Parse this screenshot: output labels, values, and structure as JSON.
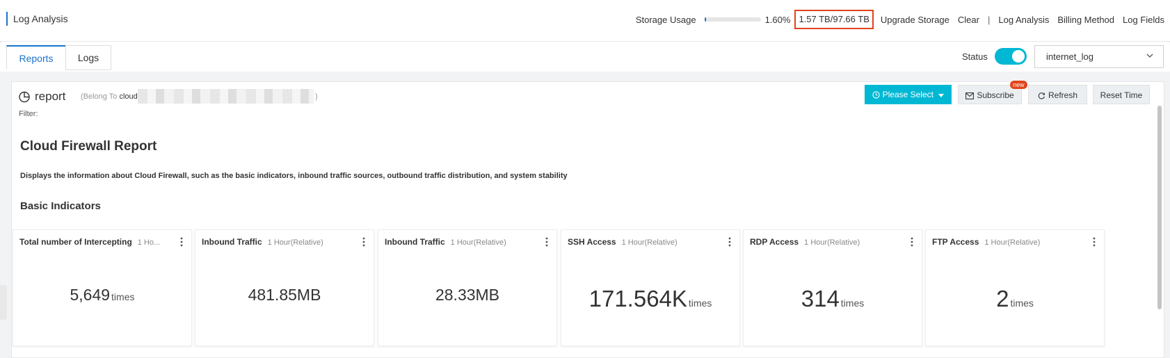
{
  "header": {
    "title": "Log Analysis",
    "storage_label": "Storage Usage",
    "storage_percent": "1.60%",
    "storage_fraction": 0.016,
    "storage_amount": "1.57 TB/97.66 TB",
    "links": [
      "Upgrade Storage",
      "Clear",
      "Log Analysis",
      "Billing Method",
      "Log Fields"
    ],
    "separator": "|"
  },
  "tabs": [
    {
      "label": "Reports",
      "active": true
    },
    {
      "label": "Logs",
      "active": false
    }
  ],
  "status": {
    "label": "Status",
    "enabled": true
  },
  "logstore": {
    "selected": "internet_log"
  },
  "report": {
    "name": "report",
    "belong_prefix": "(Belong To ",
    "belong_project": "cloud",
    "belong_suffix": ")",
    "filter_label": "Filter:",
    "buttons": {
      "select": "Please Select",
      "subscribe": "Subscribe",
      "subscribe_badge": "new",
      "refresh": "Refresh",
      "reset": "Reset Time"
    },
    "heading": "Cloud Firewall Report",
    "description": "Displays the information about Cloud Firewall, such as the basic indicators, inbound traffic sources, outbound traffic distribution, and system stability",
    "section": "Basic Indicators"
  },
  "cards": [
    {
      "title": "Total number of Intercepting",
      "time": "1 Ho...",
      "value": "5,649",
      "unit": "times",
      "big": false
    },
    {
      "title": "Inbound Traffic",
      "time": "1 Hour(Relative)",
      "value": "481.85MB",
      "unit": "",
      "big": false
    },
    {
      "title": "Inbound Traffic",
      "time": "1 Hour(Relative)",
      "value": "28.33MB",
      "unit": "",
      "big": false
    },
    {
      "title": "SSH Access",
      "time": "1 Hour(Relative)",
      "value": "171.564K",
      "unit": "times",
      "big": true
    },
    {
      "title": "RDP Access",
      "time": "1 Hour(Relative)",
      "value": "314",
      "unit": "times",
      "big": true
    },
    {
      "title": "FTP Access",
      "time": "1 Hour(Relative)",
      "value": "2",
      "unit": "times",
      "big": true
    }
  ],
  "colors": {
    "accent": "#1a73c9",
    "primary_button": "#00b8d4",
    "highlight_box": "#e0431b"
  }
}
